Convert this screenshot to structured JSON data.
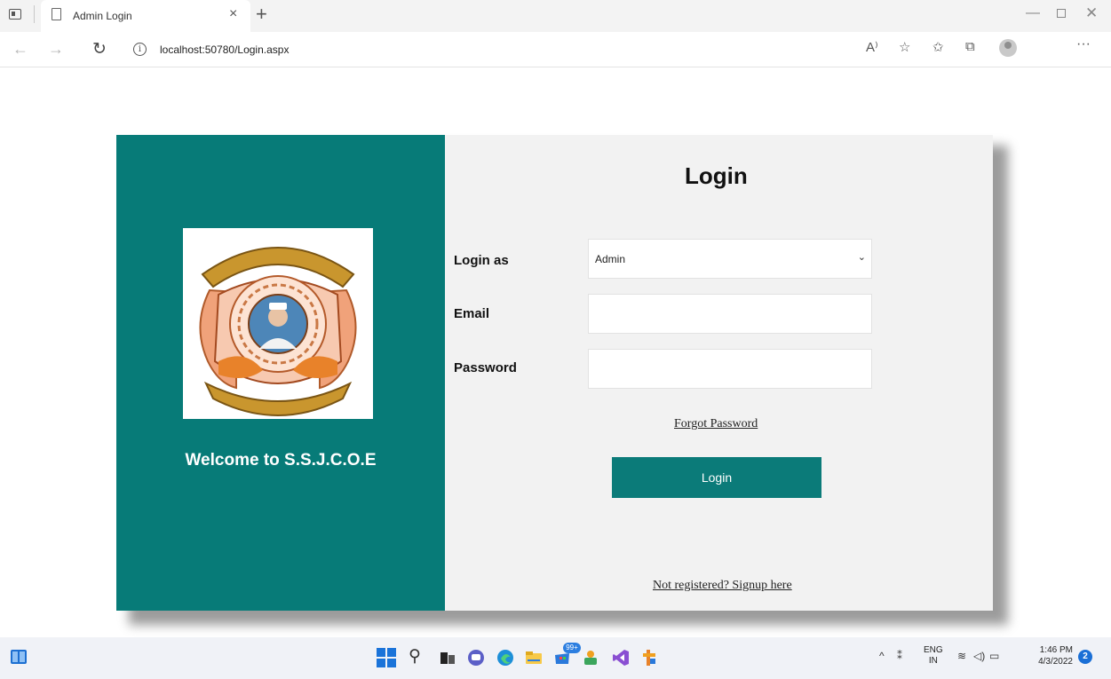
{
  "browser": {
    "tab_title": "Admin Login",
    "tab_close": "×",
    "new_tab": "+",
    "url": "localhost:50780/Login.aspx"
  },
  "page": {
    "welcome_text": "Welcome to S.S.J.C.O.E",
    "login_title": "Login",
    "login_as_label": "Login as",
    "login_as_value": "Admin",
    "email_label": "Email",
    "email_value": "",
    "password_label": "Password",
    "password_value": "",
    "forgot_password": "Forgot Password",
    "login_button": "Login",
    "signup_link": "Not registered? Signup here"
  },
  "colors": {
    "brand_teal": "#077b78",
    "panel_bg": "#f2f2f2"
  },
  "taskbar": {
    "store_badge": "99+",
    "lang_line1": "ENG",
    "lang_line2": "IN",
    "time": "1:46 PM",
    "date": "4/3/2022",
    "notifications": "2"
  }
}
